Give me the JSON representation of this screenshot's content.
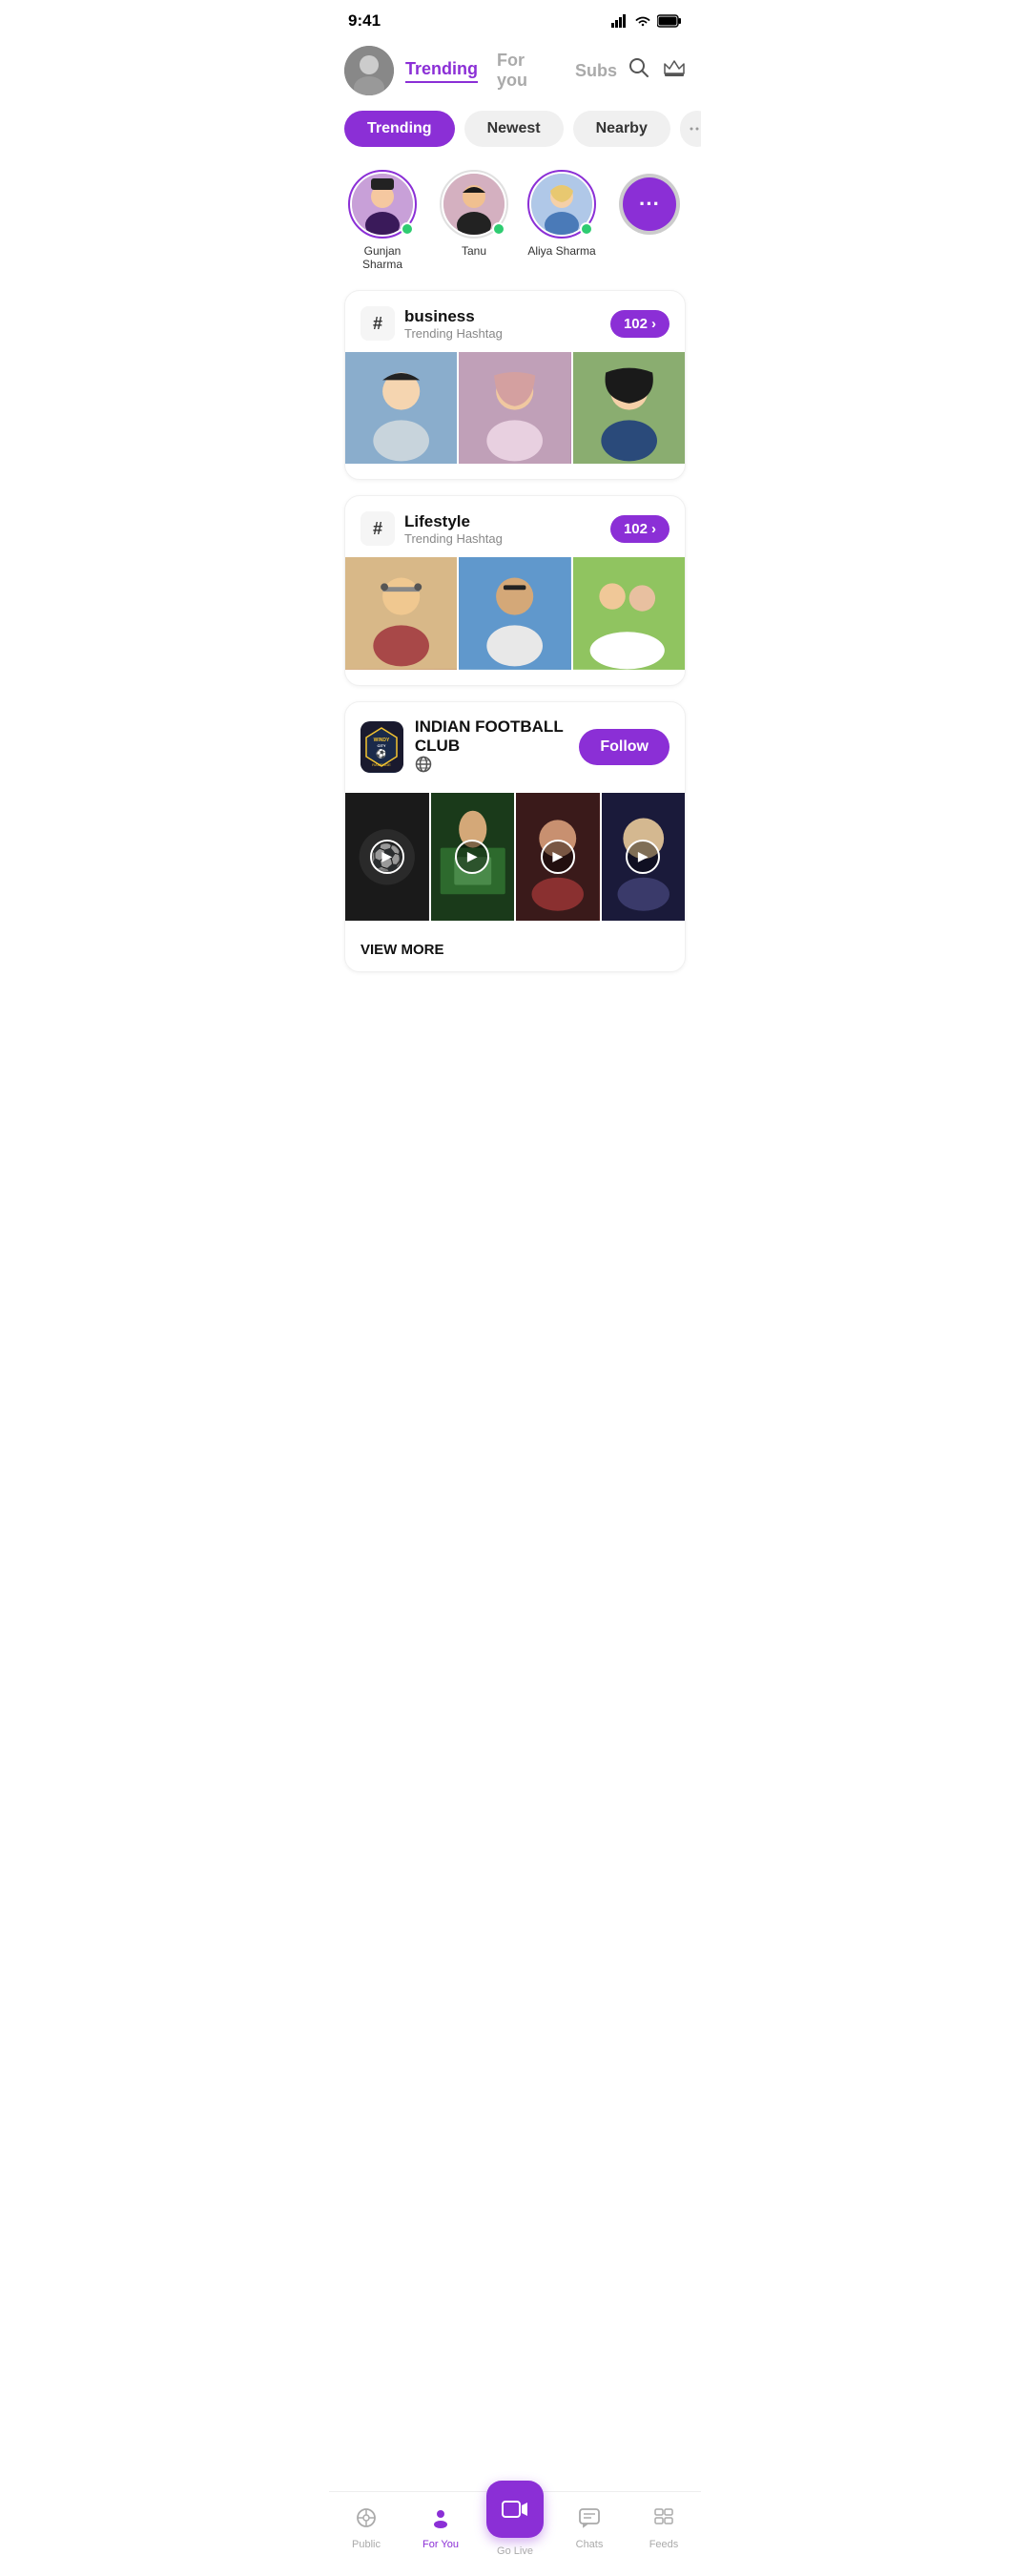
{
  "statusBar": {
    "time": "9:41",
    "signal": "▂▄▆█",
    "wifi": "wifi",
    "battery": "battery"
  },
  "header": {
    "avatar_emoji": "👩",
    "nav": [
      {
        "label": "Trending",
        "active": true
      },
      {
        "label": "For you",
        "active": false
      },
      {
        "label": "Subs",
        "active": false
      }
    ],
    "search_icon": "🔍",
    "crown_icon": "👑"
  },
  "filters": [
    {
      "label": "Trending",
      "active": true
    },
    {
      "label": "Newest",
      "active": false
    },
    {
      "label": "Nearby",
      "active": false
    }
  ],
  "stories": [
    {
      "name": "Gunjan Sharma",
      "hasRing": true,
      "isMore": false,
      "emoji": "🧘"
    },
    {
      "name": "Tanu",
      "hasRing": false,
      "isMore": false,
      "emoji": "💁"
    },
    {
      "name": "Aliya Sharma",
      "hasRing": true,
      "isMore": false,
      "emoji": "👱"
    },
    {
      "name": "",
      "hasRing": false,
      "isMore": true,
      "emoji": "···"
    }
  ],
  "hashtags": [
    {
      "tag": "business",
      "subtitle": "Trending Hashtag",
      "count": "102",
      "images": [
        {
          "color": "img-1",
          "emoji": "👩"
        },
        {
          "color": "img-2",
          "emoji": "🧕"
        },
        {
          "color": "img-3",
          "emoji": "🧕"
        }
      ]
    },
    {
      "tag": "Lifestyle",
      "subtitle": "Trending Hashtag",
      "count": "102",
      "images": [
        {
          "color": "img-4",
          "emoji": "🧑"
        },
        {
          "color": "img-5",
          "emoji": "🏋"
        },
        {
          "color": "img-6",
          "emoji": "👭"
        }
      ]
    }
  ],
  "club": {
    "logo_text1": "WINDY city",
    "logo_text2": "RAMPAGE",
    "logo_symbol": "🏆",
    "name": "INDIAN FOOTBALL CLUB",
    "globe": "🌐",
    "follow_label": "Follow",
    "view_more_label": "VIEW MORE",
    "videos": [
      {
        "color": "vid-1",
        "emoji": "⚽"
      },
      {
        "color": "vid-2",
        "emoji": "⚽"
      },
      {
        "color": "vid-3",
        "emoji": "⚽"
      },
      {
        "color": "vid-4",
        "emoji": "😐"
      }
    ]
  },
  "bottomNav": [
    {
      "label": "Public",
      "icon": "📡",
      "active": false
    },
    {
      "label": "For You",
      "icon": "👤",
      "active": true
    },
    {
      "label": "Go Live",
      "icon": "📹",
      "active": false,
      "isCenter": true
    },
    {
      "label": "Chats",
      "icon": "💬",
      "active": false
    },
    {
      "label": "Feeds",
      "icon": "📋",
      "active": false
    }
  ]
}
